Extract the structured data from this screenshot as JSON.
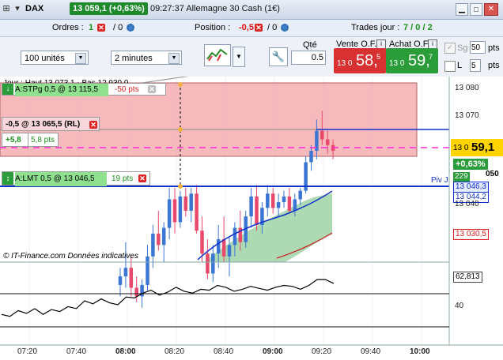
{
  "titlebar": {
    "instrument": "DAX",
    "price_badge": "13 059,1 (+0,63%)",
    "clock_title": "09:27:37 Allemagne 30 Cash (1€)"
  },
  "infobar": {
    "orders_label": "Ordres :",
    "orders_count": "1",
    "orders_zero": "/ 0",
    "position_label": "Position :",
    "position_value": "-0,5",
    "position_zero": "/ 0",
    "trades_label": "Trades jour :",
    "trades_value": "7 / 0 / 2"
  },
  "controls": {
    "units_select": "100 unités",
    "interval_select": "2 minutes",
    "qty_label": "Qté",
    "qty_value": "0.5",
    "sell_label": "Vente O.F.",
    "buy_label": "Achat O.F.",
    "sell_prefix": "13 0",
    "sell_big": "58,",
    "sell_sup": "5",
    "buy_prefix": "13 0",
    "buy_big": "59,",
    "buy_sup": "7",
    "sg_label": "Sg",
    "sg_value": "50",
    "sg_unit": "pts",
    "l_label": "L",
    "l_value": "5",
    "l_unit": "pts"
  },
  "orders": {
    "stop_label": "A:STP",
    "stop_detail": "g 0,5 @ 13 115,5",
    "stop_pts": "-50 pts",
    "position_detail": "-0,5 @ 13 065,5 (RL)",
    "pl_pts": "+5,8",
    "pl_value": "5,8 pts",
    "limit_label": "A:LMT",
    "limit_detail": "0,5 @ 13 046,5",
    "limit_pts": "19 pts"
  },
  "chart_header": "Jour : Haut 13 073,1 - Bas 12 930,0",
  "copyright": "© IT-Finance.com Données indicatives",
  "piv_label": "Piv J",
  "price_axis": {
    "ticks": [
      "13 080",
      "13 070",
      "13 040"
    ],
    "current_prefix": "13 0",
    "current_big": "59,1",
    "change": "+0,63%",
    "partial_label": "050",
    "badge_229": "229",
    "level_1": "13 046,3",
    "level_2": "13 044,2",
    "level_3": "13 030,5"
  },
  "osc_axis": {
    "value": "62,813",
    "tick": "40"
  },
  "time_axis": [
    "07:20",
    "07:40",
    "08:00",
    "08:20",
    "08:40",
    "09:00",
    "09:20",
    "09:40",
    "10:00"
  ],
  "time_axis_bold": [
    "08:00",
    "09:00",
    "10:00"
  ],
  "colors": {
    "bull": "#3b76d4",
    "bear": "#e8486b",
    "position_zone": "#f4a9ad",
    "blue_line": "#1032c8",
    "magenta_line": "#ff2ad4",
    "price_badge": "#1e8a2b",
    "sell_box": "#d83131",
    "buy_box": "#2b9c3a",
    "current_price": "#ffd400"
  },
  "chart_data": {
    "type": "candlestick",
    "y_unit": "points",
    "ylim": [
      13020,
      13085
    ],
    "candles": [
      {
        "o": 13012,
        "h": 13018,
        "l": 13008,
        "c": 13015
      },
      {
        "o": 13015,
        "h": 13027,
        "l": 13011,
        "c": 13018
      },
      {
        "o": 13018,
        "h": 13022,
        "l": 13008,
        "c": 13011
      },
      {
        "o": 13011,
        "h": 13015,
        "l": 13006,
        "c": 13008
      },
      {
        "o": 13008,
        "h": 13014,
        "l": 13004,
        "c": 13012
      },
      {
        "o": 13012,
        "h": 13026,
        "l": 13010,
        "c": 13022
      },
      {
        "o": 13022,
        "h": 13033,
        "l": 13018,
        "c": 13030
      },
      {
        "o": 13030,
        "h": 13038,
        "l": 13024,
        "c": 13026
      },
      {
        "o": 13026,
        "h": 13034,
        "l": 13020,
        "c": 13032
      },
      {
        "o": 13032,
        "h": 13046,
        "l": 13028,
        "c": 13042
      },
      {
        "o": 13042,
        "h": 13046,
        "l": 13030,
        "c": 13034
      },
      {
        "o": 13034,
        "h": 13045,
        "l": 13032,
        "c": 13043
      },
      {
        "o": 13043,
        "h": 13046,
        "l": 13036,
        "c": 13038
      },
      {
        "o": 13038,
        "h": 13046,
        "l": 13034,
        "c": 13044
      },
      {
        "o": 13044,
        "h": 13047,
        "l": 13030,
        "c": 13031
      },
      {
        "o": 13031,
        "h": 13036,
        "l": 13020,
        "c": 13023
      },
      {
        "o": 13023,
        "h": 13028,
        "l": 13014,
        "c": 13016
      },
      {
        "o": 13016,
        "h": 13026,
        "l": 13013,
        "c": 13023
      },
      {
        "o": 13023,
        "h": 13033,
        "l": 13018,
        "c": 13028
      },
      {
        "o": 13028,
        "h": 13036,
        "l": 13020,
        "c": 13022
      },
      {
        "o": 13022,
        "h": 13029,
        "l": 13015,
        "c": 13026
      },
      {
        "o": 13026,
        "h": 13034,
        "l": 13022,
        "c": 13032
      },
      {
        "o": 13032,
        "h": 13038,
        "l": 13024,
        "c": 13027
      },
      {
        "o": 13027,
        "h": 13038,
        "l": 13025,
        "c": 13036
      },
      {
        "o": 13036,
        "h": 13046,
        "l": 13032,
        "c": 13043
      },
      {
        "o": 13043,
        "h": 13047,
        "l": 13031,
        "c": 13033
      },
      {
        "o": 13033,
        "h": 13041,
        "l": 13030,
        "c": 13039
      },
      {
        "o": 13039,
        "h": 13047,
        "l": 13036,
        "c": 13044
      },
      {
        "o": 13044,
        "h": 13046,
        "l": 13037,
        "c": 13039
      },
      {
        "o": 13039,
        "h": 13044,
        "l": 13036,
        "c": 13041
      },
      {
        "o": 13041,
        "h": 13045,
        "l": 13039,
        "c": 13043
      },
      {
        "o": 13043,
        "h": 13046,
        "l": 13037,
        "c": 13038
      },
      {
        "o": 13038,
        "h": 13044,
        "l": 13036,
        "c": 13042
      },
      {
        "o": 13042,
        "h": 13046,
        "l": 13040,
        "c": 13045
      },
      {
        "o": 13045,
        "h": 13057,
        "l": 13044,
        "c": 13055
      },
      {
        "o": 13055,
        "h": 13061,
        "l": 13052,
        "c": 13059
      },
      {
        "o": 13059,
        "h": 13070,
        "l": 13056,
        "c": 13066
      },
      {
        "o": 13066,
        "h": 13073,
        "l": 13061,
        "c": 13063
      },
      {
        "o": 13063,
        "h": 13066,
        "l": 13058,
        "c": 13061
      },
      {
        "o": 13061,
        "h": 13063,
        "l": 13056,
        "c": 13059
      }
    ],
    "horizontal_lines": [
      {
        "value": 13115.5
      },
      {
        "value": 13065.5
      },
      {
        "value": 13060.0
      },
      {
        "value": 13046.5
      }
    ],
    "oscillator": {
      "values": [
        30,
        28,
        34,
        31,
        36,
        30,
        35,
        33,
        38,
        36,
        44,
        41,
        46,
        42,
        40,
        48,
        47,
        52,
        55,
        50,
        53,
        58,
        54,
        52,
        56,
        55,
        60,
        58,
        54,
        56,
        59,
        57,
        55,
        58,
        60,
        59,
        56,
        60,
        66,
        66,
        62
      ],
      "ylim": [
        0,
        80
      ],
      "levels": [
        70,
        30
      ],
      "current": 62.813
    }
  }
}
